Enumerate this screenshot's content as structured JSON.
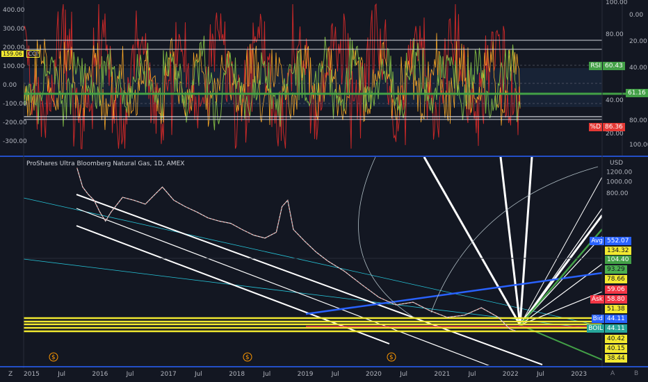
{
  "chart_data": [
    {
      "type": "line",
      "panel": "oscillators",
      "title": "",
      "series": [
        {
          "name": "CCI",
          "color": "#e53935",
          "last_value": "159.06"
        },
        {
          "name": "RSI",
          "color": "#43a047",
          "last_value": "60.43"
        },
        {
          "name": "%D",
          "color": "#e53935",
          "last_value": "86.36"
        }
      ],
      "left_axis_ticks": [
        "400.00",
        "300.00",
        "200.00",
        "100.00",
        "0.00",
        "-100.00",
        "-200.00",
        "-300.00"
      ],
      "right_axis_ticks_a": [
        "100.00",
        "80.00",
        "60.00",
        "40.00",
        "20.00"
      ],
      "right_axis_ticks_b": [
        "0.00",
        "20.00",
        "40.00",
        "60.00",
        "80.00",
        "100.00"
      ],
      "right_axis_partial_ticks": [
        "80.00",
        "40.00"
      ],
      "levels": {
        "cci_upper": 200,
        "cci_lower": -200,
        "cci_mid": 0,
        "cci_100": 100,
        "cci_m100": -100
      },
      "extra_badge": {
        "value": "61.16",
        "color": "#43a047"
      },
      "cci_value_tag": {
        "value": "159.06",
        "name": "CCI"
      }
    },
    {
      "type": "line",
      "panel": "price",
      "title": "ProShares Ultra Bloomberg Natural Gas, 1D, AMEX",
      "currency": "USD",
      "y_scale": "log",
      "y_axis_ticks": [
        "1200.00",
        "1000.00",
        "800.00"
      ],
      "x_axis_ticks": [
        "2015",
        "Jul",
        "2016",
        "Jul",
        "2017",
        "Jul",
        "2018",
        "Jul",
        "2019",
        "Jul",
        "2020",
        "Jul",
        "2021",
        "Jul",
        "2022",
        "Jul",
        "2023"
      ],
      "price_points": [
        [
          "2015-10",
          1300
        ],
        [
          "2015-11",
          900
        ],
        [
          "2015-12",
          780
        ],
        [
          "2016-01",
          700
        ],
        [
          "2016-02",
          560
        ],
        [
          "2016-03",
          470
        ],
        [
          "2016-04",
          560
        ],
        [
          "2016-06",
          740
        ],
        [
          "2016-08",
          700
        ],
        [
          "2016-10",
          650
        ],
        [
          "2016-12",
          810
        ],
        [
          "2017-01",
          900
        ],
        [
          "2017-03",
          700
        ],
        [
          "2017-05",
          620
        ],
        [
          "2017-07",
          560
        ],
        [
          "2017-09",
          500
        ],
        [
          "2017-11",
          470
        ],
        [
          "2018-01",
          450
        ],
        [
          "2018-03",
          400
        ],
        [
          "2018-05",
          360
        ],
        [
          "2018-07",
          340
        ],
        [
          "2018-09",
          380
        ],
        [
          "2018-10",
          620
        ],
        [
          "2018-11",
          700
        ],
        [
          "2018-12",
          400
        ],
        [
          "2019-02",
          320
        ],
        [
          "2019-04",
          260
        ],
        [
          "2019-06",
          220
        ],
        [
          "2019-09",
          180
        ],
        [
          "2019-12",
          140
        ],
        [
          "2020-03",
          110
        ],
        [
          "2020-06",
          95
        ],
        [
          "2020-09",
          100
        ],
        [
          "2020-12",
          85
        ],
        [
          "2021-03",
          75
        ],
        [
          "2021-06",
          78
        ],
        [
          "2021-09",
          90
        ],
        [
          "2021-12",
          75
        ],
        [
          "2022-02",
          60
        ],
        [
          "2022-03",
          58
        ]
      ],
      "price_tags": [
        {
          "label": "Avg",
          "value": "552.07",
          "bg": "#2962ff",
          "fg": "#ffffff"
        },
        {
          "label": "",
          "value": "134.32",
          "bg": "#f2e930",
          "fg": "#131722"
        },
        {
          "label": "",
          "value": "104.40",
          "bg": "#43a047",
          "fg": "#ffffff"
        },
        {
          "label": "",
          "value": "93.29",
          "bg": "#4caf50",
          "fg": "#131722"
        },
        {
          "label": "",
          "value": "78.66",
          "bg": "#f2e930",
          "fg": "#131722"
        },
        {
          "label": "",
          "value": "59.06",
          "bg": "#f23645",
          "fg": "#ffffff"
        },
        {
          "label": "Ask",
          "value": "58.80",
          "bg": "#f23645",
          "fg": "#ffffff"
        },
        {
          "label": "",
          "value": "51.38",
          "bg": "#f2e930",
          "fg": "#131722"
        },
        {
          "label": "Bid",
          "value": "44.11",
          "bg": "#2962ff",
          "fg": "#ffffff"
        },
        {
          "label": "BOIL",
          "value": "44.11",
          "bg": "#26a69a",
          "fg": "#ffffff"
        },
        {
          "label": "",
          "value": "40.42",
          "bg": "#f2e930",
          "fg": "#131722"
        },
        {
          "label": "",
          "value": "40.15",
          "bg": "#f2e930",
          "fg": "#131722"
        },
        {
          "label": "",
          "value": "38.44",
          "bg": "#f2e930",
          "fg": "#131722"
        }
      ],
      "dividend_markers": [
        "$",
        "$",
        "$"
      ]
    }
  ],
  "toolbar": {
    "left_icon": "Z",
    "right_icons": [
      "A",
      "B"
    ]
  }
}
